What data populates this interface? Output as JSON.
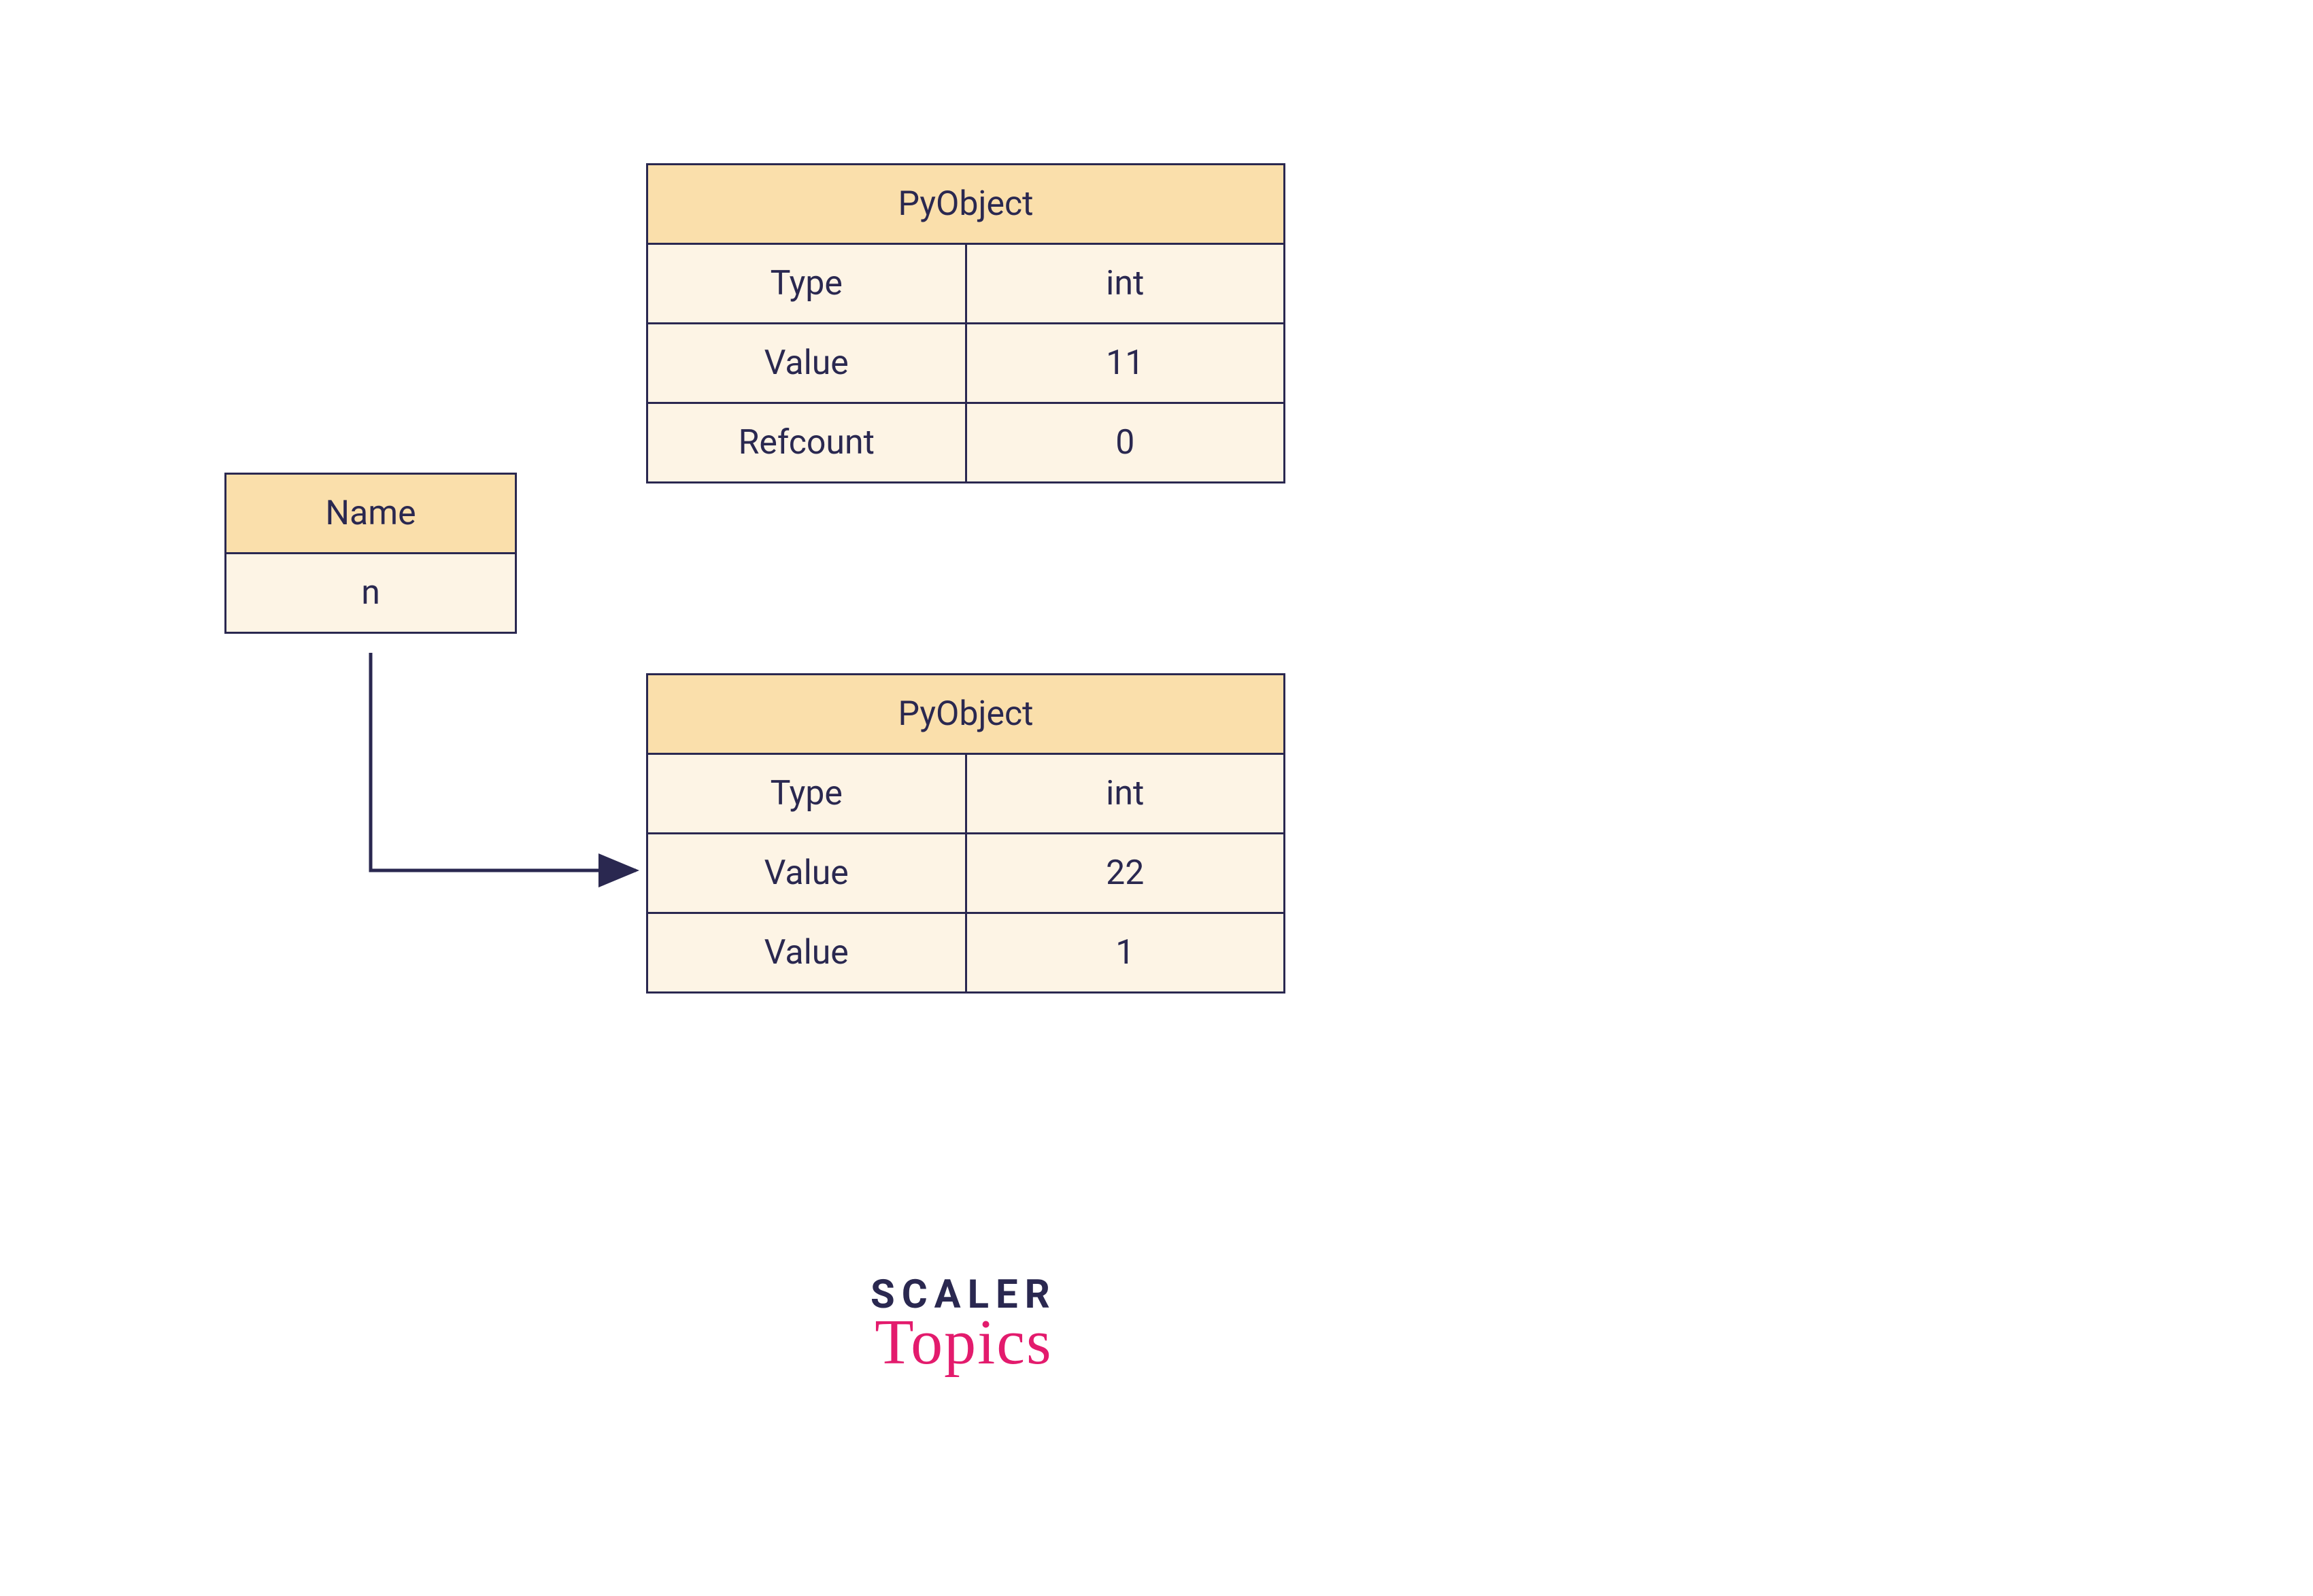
{
  "name_box": {
    "header": "Name",
    "value": "n"
  },
  "pyobject_1": {
    "header": "PyObject",
    "rows": [
      {
        "label": "Type",
        "value": "int"
      },
      {
        "label": "Value",
        "value": "11"
      },
      {
        "label": "Refcount",
        "value": "0"
      }
    ]
  },
  "pyobject_2": {
    "header": "PyObject",
    "rows": [
      {
        "label": "Type",
        "value": "int"
      },
      {
        "label": "Value",
        "value": "22"
      },
      {
        "label": "Value",
        "value": "1"
      }
    ]
  },
  "logo": {
    "line1": "SCALER",
    "line2": "Topics"
  },
  "colors": {
    "border": "#2a2850",
    "header_bg": "#fadfab",
    "cell_bg": "#fdf4e5",
    "accent": "#e31b6d"
  }
}
